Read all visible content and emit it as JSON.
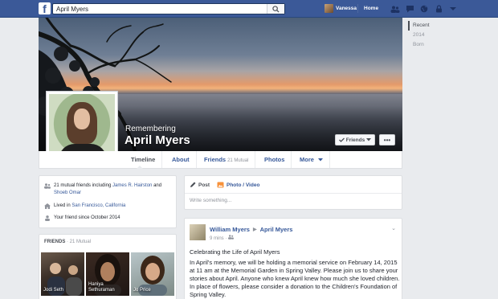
{
  "topbar": {
    "search_value": "April Myers",
    "user_name": "Vanessa",
    "home_label": "Home"
  },
  "profile": {
    "remembering_label": "Remembering",
    "name": "April Myers",
    "friends_button": "Friends",
    "more_button": "•••"
  },
  "nav": {
    "tabs": [
      {
        "label": "Timeline"
      },
      {
        "label": "About"
      },
      {
        "label": "Friends",
        "sub": "21 Mutual"
      },
      {
        "label": "Photos"
      },
      {
        "label": "More"
      }
    ]
  },
  "years": [
    "Recent",
    "2014",
    "Born"
  ],
  "intro": {
    "mutual_prefix": "21 mutual friends including ",
    "mutual_friend1": "James R. Hairston",
    "mutual_and": " and",
    "mutual_friend2": "Shoeb Omar",
    "lived_prefix": "Lived in ",
    "lived_place": "San Francisco, California",
    "friend_since": "Your friend since October 2014"
  },
  "friends_section": {
    "title": "FRIENDS",
    "sub": "· 21 Mutual",
    "friends": [
      {
        "name": "Jodi Seth"
      },
      {
        "name": "Haniya Sethuraman"
      },
      {
        "name": "Jo Price"
      }
    ]
  },
  "composer": {
    "post_tab": "Post",
    "photo_tab": "Photo / Video",
    "placeholder": "Write something..."
  },
  "post": {
    "author": "William Myers",
    "recipient": "April Myers",
    "meta": "9 mins · ",
    "title": "Celebrating the Life of April Myers",
    "body": "In April's memory, we will be holding a memorial service on February 14, 2015 at 11 am at the Memorial Garden in Spring Valley. Please join us to share your stories about April. Anyone who knew April knew how much she loved children. In place of flowers, please consider a donation to the Children's Foundation of Spring Valley."
  },
  "colors": {
    "brand": "#3b5998",
    "link": "#365899",
    "background": "#e9ebee"
  }
}
